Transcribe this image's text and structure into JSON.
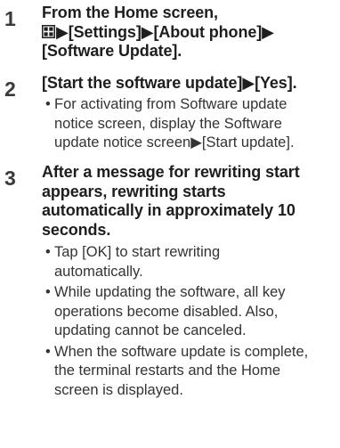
{
  "steps": [
    {
      "number": "1",
      "title_lines": [
        [
          "From the Home screen,"
        ],
        [
          "▶[Settings]▶[About phone]▶"
        ],
        [
          "[Software Update]."
        ]
      ],
      "icon": "home-grid-icon",
      "notes": []
    },
    {
      "number": "2",
      "title_lines": [
        [
          "[Start the software update]▶[Yes]."
        ]
      ],
      "notes": [
        {
          "lines": [
            "For activating from Software update",
            "notice screen, display the Software",
            "update notice screen▶[Start update]."
          ]
        }
      ]
    },
    {
      "number": "3",
      "title_lines": [
        [
          "After a message for rewriting start"
        ],
        [
          "appears, rewriting starts"
        ],
        [
          "automatically in approximately 10"
        ],
        [
          "seconds."
        ]
      ],
      "notes": [
        {
          "lines": [
            "Tap [OK] to start rewriting",
            "automatically."
          ]
        },
        {
          "lines": [
            "While updating the software, all key",
            "operations become disabled. Also,",
            "updating cannot be canceled."
          ]
        },
        {
          "lines": [
            "When the software update is complete,",
            "the terminal restarts and the Home",
            "screen is displayed."
          ]
        }
      ]
    }
  ],
  "bullet_char": "•"
}
